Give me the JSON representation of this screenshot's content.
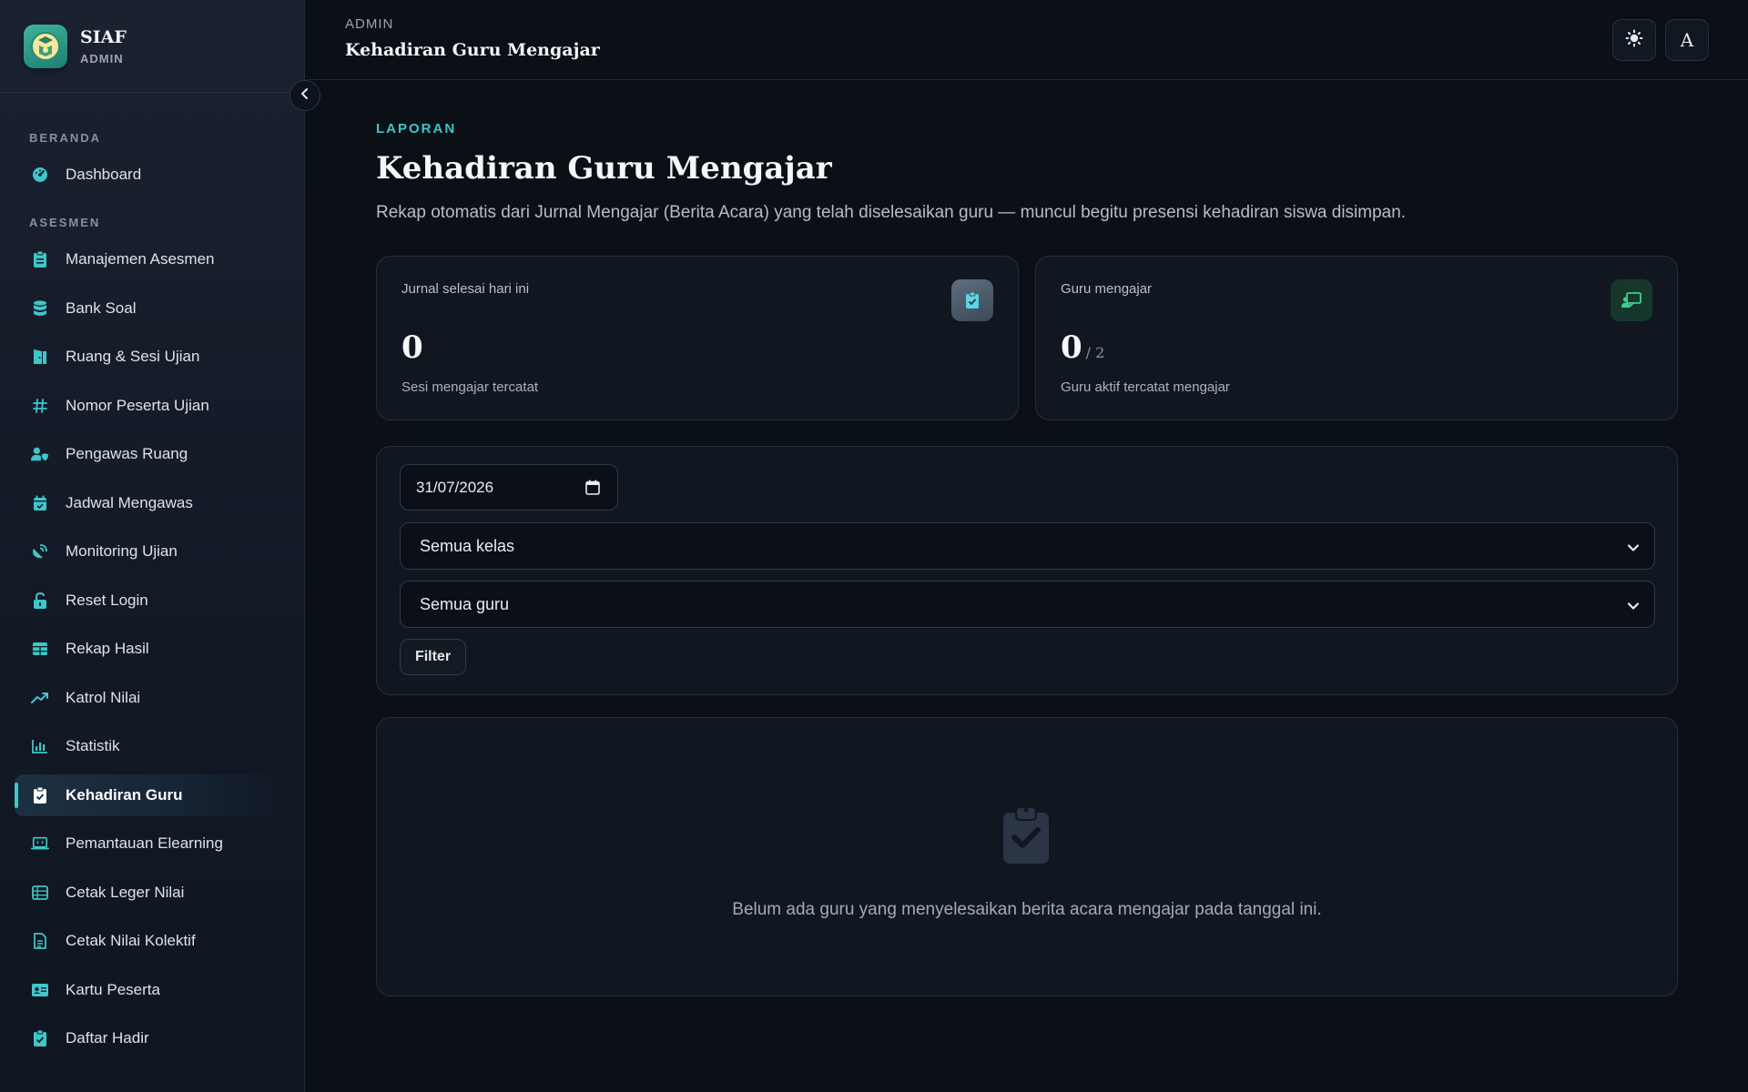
{
  "brand": {
    "name": "SIAF",
    "role": "ADMIN"
  },
  "sidebar": {
    "sections": [
      {
        "label": "BERANDA"
      },
      {
        "label": "ASESMEN"
      }
    ],
    "items": [
      {
        "label": "Dashboard",
        "icon": "gauge-icon"
      },
      {
        "label": "Manajemen Asesmen",
        "icon": "clipboard-list-icon"
      },
      {
        "label": "Bank Soal",
        "icon": "database-icon"
      },
      {
        "label": "Ruang & Sesi Ujian",
        "icon": "door-icon"
      },
      {
        "label": "Nomor Peserta Ujian",
        "icon": "hashtag-icon"
      },
      {
        "label": "Pengawas Ruang",
        "icon": "user-shield-icon"
      },
      {
        "label": "Jadwal Mengawas",
        "icon": "calendar-check-icon"
      },
      {
        "label": "Monitoring Ujian",
        "icon": "satellite-dish-icon"
      },
      {
        "label": "Reset Login",
        "icon": "unlock-icon"
      },
      {
        "label": "Rekap Hasil",
        "icon": "table-icon"
      },
      {
        "label": "Katrol Nilai",
        "icon": "trend-up-icon"
      },
      {
        "label": "Statistik",
        "icon": "bar-chart-icon"
      },
      {
        "label": "Kehadiran Guru",
        "icon": "clipboard-check-icon",
        "active": true
      },
      {
        "label": "Pemantauan Elearning",
        "icon": "laptop-code-icon"
      },
      {
        "label": "Cetak Leger Nilai",
        "icon": "list-table-icon"
      },
      {
        "label": "Cetak Nilai Kolektif",
        "icon": "file-lines-icon"
      },
      {
        "label": "Kartu Peserta",
        "icon": "id-card-icon"
      },
      {
        "label": "Daftar Hadir",
        "icon": "clipboard-check-icon"
      }
    ]
  },
  "topbar": {
    "breadcrumb": "ADMIN",
    "title": "Kehadiran Guru Mengajar",
    "theme_icon": "sun-icon",
    "avatar_letter": "A"
  },
  "page": {
    "eyebrow": "LAPORAN",
    "title": "Kehadiran Guru Mengajar",
    "description": "Rekap otomatis dari Jurnal Mengajar (Berita Acara) yang telah diselesaikan guru — muncul begitu presensi kehadiran siswa disimpan."
  },
  "stats": [
    {
      "label": "Jurnal selesai hari ini",
      "value": "0",
      "sub": "Sesi mengajar tercatat",
      "icon": "clipboard-check-icon"
    },
    {
      "label": "Guru mengajar",
      "value": "0",
      "total": "/ 2",
      "sub": "Guru aktif tercatat mengajar",
      "icon": "chalkboard-teacher-icon"
    }
  ],
  "filters": {
    "date_value": "31/07/2026",
    "class_select": "Semua kelas",
    "teacher_select": "Semua guru",
    "filter_label": "Filter"
  },
  "empty_state": {
    "message": "Belum ada guru yang menyelesaikan berita acara mengajar pada tanggal ini."
  },
  "colors": {
    "accent": "#3fc6c9",
    "green": "#3ecf8e",
    "background": "#0b0f16",
    "card": "#111720"
  }
}
